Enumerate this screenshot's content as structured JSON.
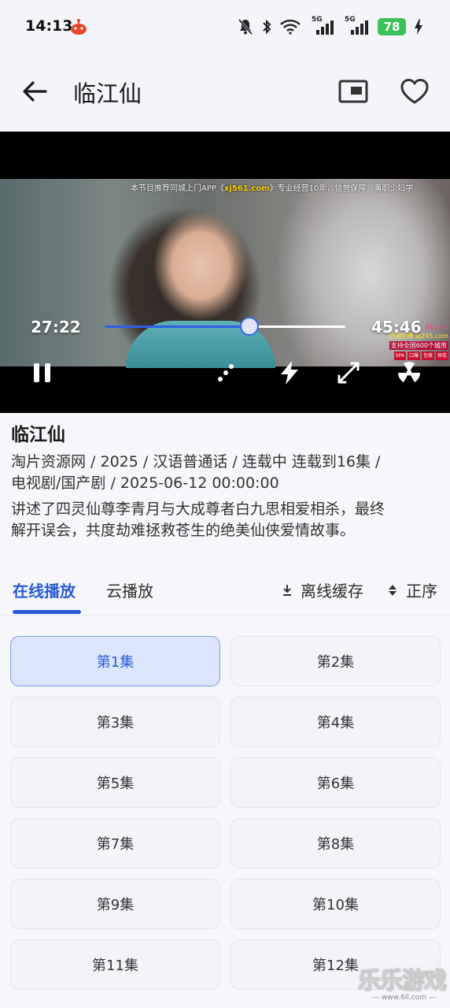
{
  "status_bar": {
    "time": "14:13",
    "network_1": "5G",
    "network_2": "5G",
    "battery": "78"
  },
  "app_bar": {
    "title": "临江仙",
    "icons": [
      "arrow-left-icon",
      "pip-icon",
      "heart-icon"
    ]
  },
  "player": {
    "current_time": "27:22",
    "total_time": "45:46",
    "progress": 0.6,
    "ad_top_prefix": "本节目推荐同城上门APP《",
    "ad_top_domain": "xj561.com",
    "ad_top_suffix": "》专业经营10年，信誉保障，兼职少妇学",
    "ad_side_line1": "86.com",
    "ad_side_line2": "全国空降 xj245.com",
    "ad_side_line3": "支持全国600个城市",
    "ad_side_tags": [
      "SPA",
      "口爆",
      "包夜",
      "探花"
    ]
  },
  "info": {
    "title": "临江仙",
    "meta_line1": "淘片资源网 / 2025 / 汉语普通话 / 连载中 连载到16集 /",
    "meta_line2": "电视剧/国产剧 / 2025-06-12 00:00:00",
    "desc_line1": "讲述了四灵仙尊李青月与大成尊者白九思相爱相杀，最终",
    "desc_line2": "解开误会，共度劫难拯救苍生的绝美仙侠爱情故事。"
  },
  "tabs": {
    "online": "在线播放",
    "cloud": "云播放",
    "offline": "离线缓存",
    "order": "正序"
  },
  "episodes": [
    "第1集",
    "第2集",
    "第3集",
    "第4集",
    "第5集",
    "第6集",
    "第7集",
    "第8集",
    "第9集",
    "第10集",
    "第11集",
    "第12集"
  ],
  "selected_episode": "第1集",
  "watermark": {
    "title": "乐乐游戏",
    "url": "— www.6ll.com —"
  },
  "colors": {
    "accent": "#2a5bd7",
    "battery": "#3cc25a",
    "selected_bg": "#dbe5fb"
  }
}
